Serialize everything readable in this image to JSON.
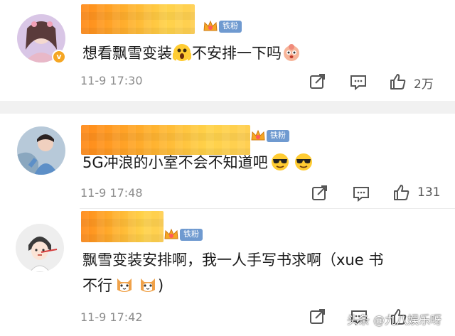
{
  "comments": [
    {
      "badge": "铁粉",
      "text": "想看飘雪变装",
      "text_after": "不安排一下吗",
      "emoji_1": "shocked-face-emoji",
      "emoji_2": "cute-pink-face-emoji",
      "time": "11-9 17:30",
      "likes": "2万",
      "verified": true,
      "icons": [
        "share-icon",
        "comment-icon",
        "like-icon"
      ]
    },
    {
      "badge": "铁粉",
      "text": "5G冲浪的小室不会不知道吧",
      "emoji_1": "sunglasses-face-emoji",
      "emoji_2": "sunglasses-face-emoji",
      "time": "11-9 17:48",
      "likes": "131",
      "icons": [
        "share-icon",
        "comment-icon",
        "like-icon"
      ]
    },
    {
      "badge": "铁粉",
      "text_line1": "飘雪变装安排啊，我一人手写书求啊（xue 书",
      "text_line2": "不行",
      "text_line2_after": ")",
      "emoji_1": "cat-face-emoji",
      "emoji_2": "cat-face-emoji",
      "time": "11-9 17:42",
      "icons": [
        "share-icon",
        "comment-icon",
        "like-icon"
      ]
    }
  ],
  "watermark": "头条 @九八娱乐呀",
  "colors": {
    "fan_badge": "#6f9ad0",
    "redacted_name": "#ffb02e",
    "divider": "#f1f1f1",
    "meta_text": "#8c8c8c"
  }
}
